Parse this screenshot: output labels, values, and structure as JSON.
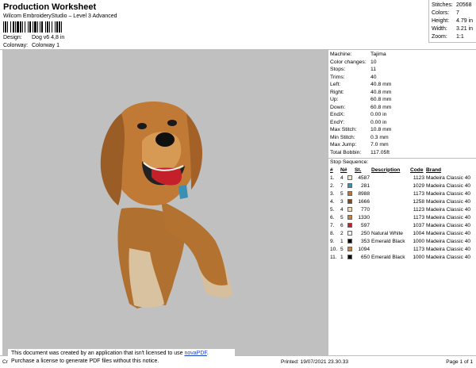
{
  "header": {
    "title": "Production Worksheet",
    "subtitle": "Wilcom EmbroideryStudio – Level 3 Advanced",
    "design_label": "Design:",
    "design_value": "Dog v6 4,8 in",
    "colorway_label": "Colorway:",
    "colorway_value": "Colorway 1"
  },
  "stats": [
    {
      "label": "Stitches:",
      "value": "20568"
    },
    {
      "label": "Colors:",
      "value": "7"
    },
    {
      "label": "Height:",
      "value": "4.79 in"
    },
    {
      "label": "Width:",
      "value": "3.21 in"
    },
    {
      "label": "Zoom:",
      "value": "1:1"
    }
  ],
  "machine_info": [
    {
      "label": "Machine:",
      "value": "Tajima"
    },
    {
      "label": "Color changes:",
      "value": "10"
    },
    {
      "label": "Stops:",
      "value": "11"
    },
    {
      "label": "Trims:",
      "value": "40"
    },
    {
      "label": "Left:",
      "value": "40.8 mm"
    },
    {
      "label": "Right:",
      "value": "40.8 mm"
    },
    {
      "label": "Up:",
      "value": "60.8 mm"
    },
    {
      "label": "Down:",
      "value": "60.8 mm"
    },
    {
      "label": "EndX:",
      "value": "0.00 in"
    },
    {
      "label": "EndY:",
      "value": "0.00 in"
    },
    {
      "label": "Max Stitch:",
      "value": "10.8 mm"
    },
    {
      "label": "Min Stitch:",
      "value": "0.3 mm"
    },
    {
      "label": "Max Jump:",
      "value": "7.0 mm"
    },
    {
      "label": "Total Bobbin:",
      "value": "117.05ft"
    }
  ],
  "stop_sequence": {
    "title": "Stop Sequence:",
    "headers": {
      "idx": "#",
      "n": "N#",
      "st": "St.",
      "desc": "Description",
      "code": "Code",
      "brand": "Brand"
    },
    "rows": [
      {
        "idx": "1.",
        "n": "4",
        "color": "#f3e9d0",
        "st": "4587",
        "desc": "",
        "code": "1123",
        "brand": "Madeira Classic 40"
      },
      {
        "idx": "2.",
        "n": "7",
        "color": "#3a8fb4",
        "st": "281",
        "desc": "",
        "code": "1029",
        "brand": "Madeira Classic 40"
      },
      {
        "idx": "3.",
        "n": "5",
        "color": "#b8753b",
        "st": "8988",
        "desc": "",
        "code": "1173",
        "brand": "Madeira Classic 40"
      },
      {
        "idx": "4.",
        "n": "3",
        "color": "#7a4a24",
        "st": "1666",
        "desc": "",
        "code": "1258",
        "brand": "Madeira Classic 40"
      },
      {
        "idx": "5.",
        "n": "4",
        "color": "#f3d9b0",
        "st": "770",
        "desc": "",
        "code": "1123",
        "brand": "Madeira Classic 40"
      },
      {
        "idx": "6.",
        "n": "5",
        "color": "#c08545",
        "st": "1330",
        "desc": "",
        "code": "1173",
        "brand": "Madeira Classic 40"
      },
      {
        "idx": "7.",
        "n": "6",
        "color": "#c4202a",
        "st": "597",
        "desc": "",
        "code": "1037",
        "brand": "Madeira Classic 40"
      },
      {
        "idx": "8.",
        "n": "2",
        "color": "#f2f2f2",
        "st": "250",
        "desc": "Natural White",
        "code": "1004",
        "brand": "Madeira Classic 40"
      },
      {
        "idx": "9.",
        "n": "1",
        "color": "#0a0a0a",
        "st": "353",
        "desc": "Emerald Black",
        "code": "1000",
        "brand": "Madeira Classic 40"
      },
      {
        "idx": "10.",
        "n": "5",
        "color": "#c08545",
        "st": "1094",
        "desc": "",
        "code": "1173",
        "brand": "Madeira Classic 40"
      },
      {
        "idx": "11.",
        "n": "1",
        "color": "#0a0a0a",
        "st": "650",
        "desc": "Emerald Black",
        "code": "1000",
        "brand": "Madeira Classic 40"
      }
    ]
  },
  "footer": {
    "cr": "Cr",
    "printed": "Printed: 19/07/2021 23.30.33",
    "page": "Page 1 of 1"
  },
  "notice": {
    "line1_prefix": "This document was created by an application that isn't licensed to use ",
    "link": "novaPDF",
    "line1_suffix": ".",
    "line2": "Purchase a license to generate PDF files without this notice."
  },
  "icons": {
    "barcode": "barcode-icon",
    "design_preview": "embroidery-dog-preview"
  },
  "colors": {
    "canvas_bg": "#c0c0c0",
    "fur": "#b8753b",
    "link": "#1a3fc6"
  }
}
